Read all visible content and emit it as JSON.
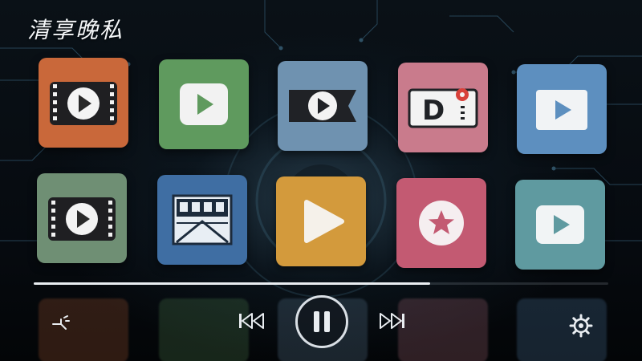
{
  "header": {
    "title": "清享晚私"
  },
  "colors": {
    "tile_orange": "#c9683a",
    "tile_green": "#5f9a5e",
    "tile_blue_gray": "#6f92b0",
    "tile_pink": "#c97b8c",
    "tile_steel_blue": "#5d8fbf",
    "tile_sage": "#6f8f74",
    "tile_navy": "#3f6ea3",
    "tile_amber": "#d39a3c",
    "tile_rose": "#c35a72",
    "tile_teal": "#5f9aa0",
    "progress": "#e9edf1"
  },
  "apps": [
    {
      "icon": "film-play-icon"
    },
    {
      "icon": "play-icon"
    },
    {
      "icon": "video-tag-play-icon"
    },
    {
      "icon": "d-tv-icon"
    },
    {
      "icon": "play-icon"
    },
    {
      "icon": "film-play-icon"
    },
    {
      "icon": "cinema-poster-icon"
    },
    {
      "icon": "play-icon"
    },
    {
      "icon": "star-icon"
    },
    {
      "icon": "play-icon"
    }
  ],
  "player": {
    "progress": 0.69,
    "controls": [
      "connect-icon",
      "previous-icon",
      "pause-icon",
      "next-icon",
      "settings-icon"
    ]
  }
}
